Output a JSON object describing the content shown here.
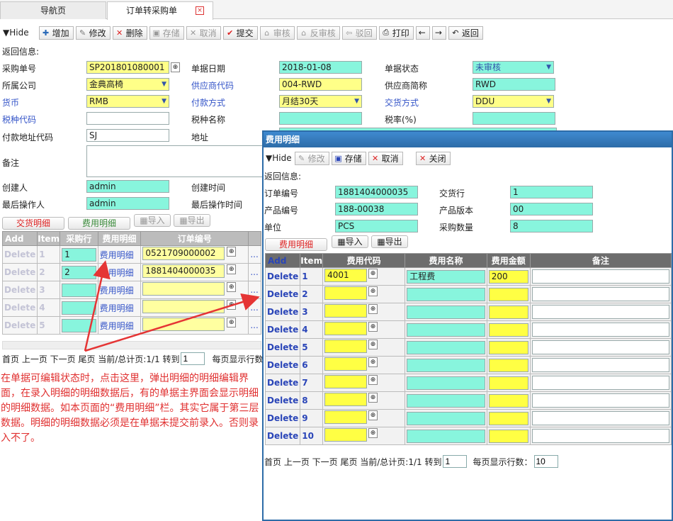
{
  "tabs": {
    "nav": "导航页",
    "order": "订单转采购单",
    "close": "×"
  },
  "toolbar": {
    "hide": "▼Hide",
    "add": "增加",
    "edit": "修改",
    "delete": "删除",
    "save": "存储",
    "cancel": "取消",
    "submit": "提交",
    "audit": "审核",
    "unaudit": "反审核",
    "reject": "驳回",
    "print": "打印",
    "prev": "←",
    "next": "→",
    "back": "返回"
  },
  "form": {
    "return_info": "返回信息:",
    "purchase_no_label": "采购单号",
    "purchase_no": "SP201801080001",
    "doc_date_label": "单据日期",
    "doc_date": "2018-01-08",
    "doc_status_label": "单据状态",
    "doc_status": "未审核",
    "company_label": "所属公司",
    "company": "金典高椅",
    "supplier_code_label": "供应商代码",
    "supplier_code": "004-RWD",
    "supplier_short_label": "供应商简称",
    "supplier_short": "RWD",
    "currency_label": "货币",
    "currency": "RMB",
    "payment_label": "付款方式",
    "payment": "月结30天",
    "delivery_label": "交货方式",
    "delivery": "DDU",
    "tax_code_label": "税种代码",
    "tax_code": "",
    "tax_name_label": "税种名称",
    "tax_name": "",
    "tax_rate_label": "税率(%)",
    "tax_rate": "",
    "pay_addr_code_label": "付款地址代码",
    "pay_addr_code": "SJ",
    "address_label": "地址",
    "remark_label": "备注",
    "creator_label": "创建人",
    "creator": "admin",
    "create_time_label": "创建时间",
    "last_operator_label": "最后操作人",
    "last_operator": "admin",
    "last_op_time_label": "最后操作时间"
  },
  "main_grid": {
    "btn_delivery": "交货明细",
    "btn_fee": "费用明细",
    "btn_import": "导入",
    "btn_export": "导出",
    "headers": [
      "Add",
      "Item",
      "采购行",
      "费用明细",
      "订单编号"
    ],
    "delete_label": "Delete",
    "link_label": "费用明细",
    "more": "...",
    "rows": [
      {
        "item": "1",
        "line": "1",
        "order": "0521709000002"
      },
      {
        "item": "2",
        "line": "2",
        "order": "1881404000035"
      },
      {
        "item": "3",
        "line": "",
        "order": ""
      },
      {
        "item": "4",
        "line": "",
        "order": ""
      },
      {
        "item": "5",
        "line": "",
        "order": ""
      }
    ],
    "pager": {
      "text": "首页 上一页 下一页 尾页 当前/总计页:1/1 转到",
      "goto": "1",
      "page_size_label": "每页显示行数:"
    }
  },
  "annotation": "在单据可编辑状态时，点击这里，弹出明细的明细编辑界面，在录入明细的明细数据后，有的单据主界面会显示明细的明细数据。如本页面的“费用明细”栏。其实它属于第三层数据。明细的明细数据必须是在单据未提交前录入。否则录入不了。",
  "dialog": {
    "title": "费用明细",
    "toolbar": {
      "hide": "▼Hide",
      "edit": "修改",
      "save": "存储",
      "cancel": "取消",
      "close": "关闭"
    },
    "return_info": "返回信息:",
    "order_no_label": "订单编号",
    "order_no": "1881404000035",
    "delivery_line_label": "交货行",
    "delivery_line": "1",
    "product_no_label": "产品编号",
    "product_no": "188-00038",
    "product_version_label": "产品版本",
    "product_version": "00",
    "unit_label": "单位",
    "unit": "PCS",
    "qty_label": "采购数量",
    "qty": "8",
    "btn_fee": "费用明细",
    "btn_import": "导入",
    "btn_export": "导出",
    "headers": [
      "Add",
      "Item",
      "费用代码",
      "费用名称",
      "费用金额",
      "备注"
    ],
    "delete_label": "Delete",
    "rows": [
      {
        "item": "1",
        "code": "4001",
        "name": "工程费",
        "amount": "200",
        "remark": ""
      },
      {
        "item": "2",
        "code": "",
        "name": "",
        "amount": "",
        "remark": ""
      },
      {
        "item": "3",
        "code": "",
        "name": "",
        "amount": "",
        "remark": ""
      },
      {
        "item": "4",
        "code": "",
        "name": "",
        "amount": "",
        "remark": ""
      },
      {
        "item": "5",
        "code": "",
        "name": "",
        "amount": "",
        "remark": ""
      },
      {
        "item": "6",
        "code": "",
        "name": "",
        "amount": "",
        "remark": ""
      },
      {
        "item": "7",
        "code": "",
        "name": "",
        "amount": "",
        "remark": ""
      },
      {
        "item": "8",
        "code": "",
        "name": "",
        "amount": "",
        "remark": ""
      },
      {
        "item": "9",
        "code": "",
        "name": "",
        "amount": "",
        "remark": ""
      },
      {
        "item": "10",
        "code": "",
        "name": "",
        "amount": "",
        "remark": ""
      }
    ],
    "pager": {
      "text": "首页 上一页 下一页 尾页 当前/总计页:1/1 转到",
      "goto": "1",
      "page_size_label": "每页显示行数：",
      "page_size": "10"
    }
  },
  "colors": {
    "required": "#ffff88",
    "readonly": "#88f5dd",
    "annotation": "#e03030",
    "dialog_border": "#2d6ca8"
  }
}
